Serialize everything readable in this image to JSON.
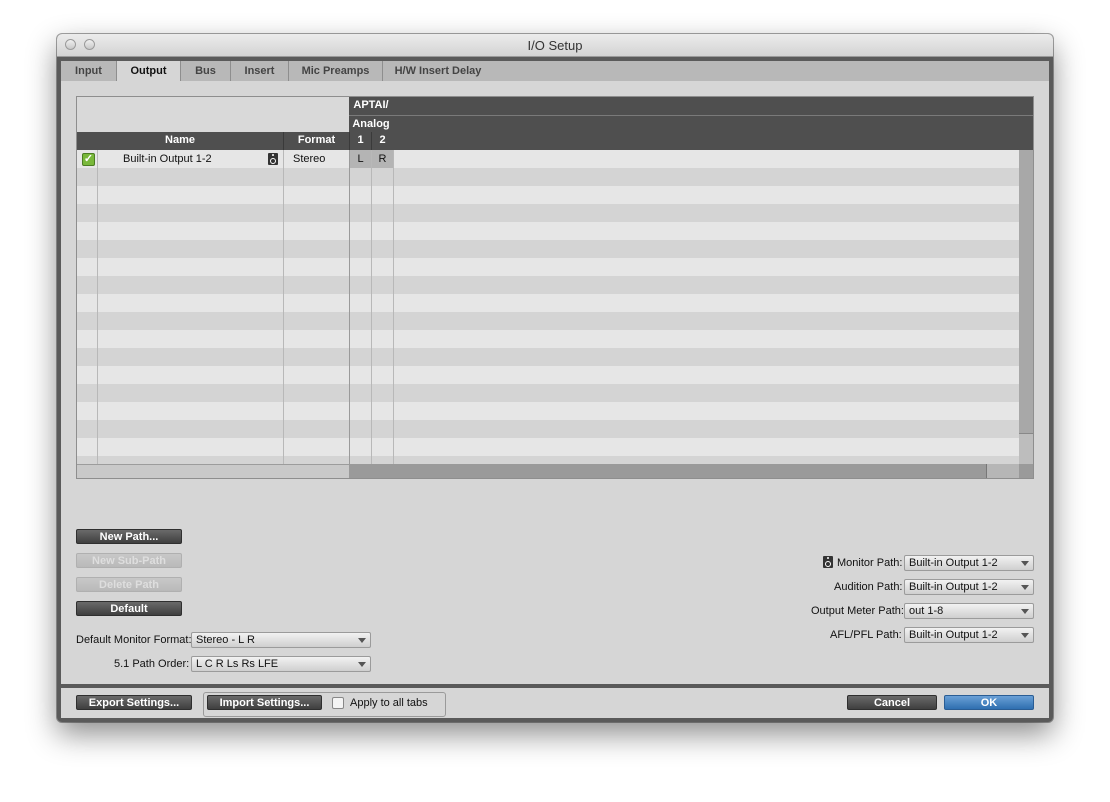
{
  "window": {
    "title": "I/O Setup"
  },
  "tabs": [
    {
      "label": "Input"
    },
    {
      "label": "Output"
    },
    {
      "label": "Bus"
    },
    {
      "label": "Insert"
    },
    {
      "label": "Mic Preamps"
    },
    {
      "label": "H/W Insert Delay"
    }
  ],
  "active_tab": "Output",
  "grid": {
    "device_header": "APTAI/",
    "group_header": "Analog",
    "columns": {
      "name": "Name",
      "format": "Format",
      "ch1": "1",
      "ch2": "2"
    },
    "rows": [
      {
        "enabled": true,
        "name": "Built-in Output 1-2",
        "format": "Stereo",
        "ch1": "L",
        "ch2": "R",
        "icon": "speaker-icon"
      }
    ]
  },
  "buttons": {
    "new_path": "New Path...",
    "new_sub_path": "New Sub-Path",
    "delete_path": "Delete Path",
    "default": "Default"
  },
  "fields": {
    "default_monitor_format": {
      "label": "Default Monitor Format:",
      "value": "Stereo - L R"
    },
    "path_order": {
      "label": "5.1 Path Order:",
      "value": "L C R Ls Rs LFE"
    },
    "monitor_path": {
      "label": "Monitor Path:",
      "value": "Built-in Output 1-2"
    },
    "audition_path": {
      "label": "Audition Path:",
      "value": "Built-in Output 1-2"
    },
    "output_meter_path": {
      "label": "Output Meter Path:",
      "value": "out 1-8"
    },
    "afl_pfl_path": {
      "label": "AFL/PFL Path:",
      "value": "Built-in Output 1-2"
    }
  },
  "bottom": {
    "export": "Export Settings...",
    "import": "Import Settings...",
    "apply_all": "Apply to all tabs",
    "cancel": "Cancel",
    "ok": "OK"
  },
  "colors": {
    "ok_button": "#2f6fb0",
    "check_green": "#79b83a",
    "header_dark": "#4f4f4f"
  }
}
